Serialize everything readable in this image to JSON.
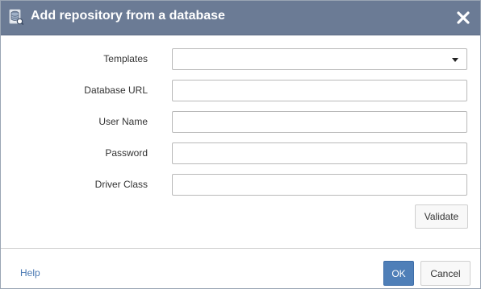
{
  "dialog": {
    "title": "Add repository from a database",
    "title_icon": "database-icon",
    "close_icon": "close-icon"
  },
  "form": {
    "templates": {
      "label": "Templates",
      "value": ""
    },
    "database_url": {
      "label": "Database URL",
      "value": ""
    },
    "user_name": {
      "label": "User Name",
      "value": ""
    },
    "password": {
      "label": "Password",
      "value": ""
    },
    "driver_class": {
      "label": "Driver Class",
      "value": ""
    }
  },
  "buttons": {
    "validate": "Validate",
    "ok": "OK",
    "cancel": "Cancel"
  },
  "footer": {
    "help": "Help"
  },
  "colors": {
    "titlebar": "#6b7b95",
    "primary_button": "#4f7fb8",
    "link": "#4a79b3"
  }
}
